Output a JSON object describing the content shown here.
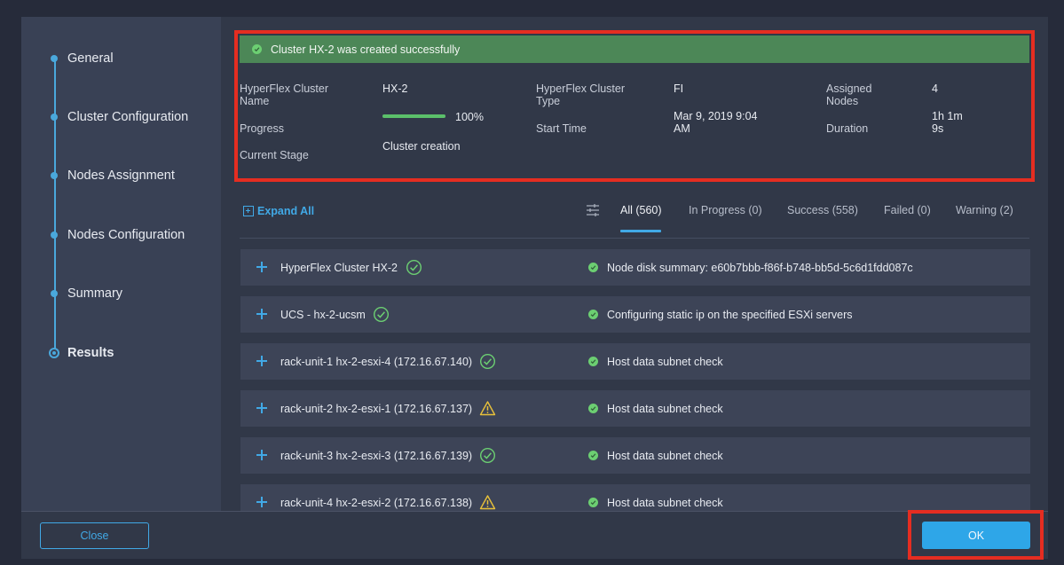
{
  "steps": [
    {
      "label": "General"
    },
    {
      "label": "Cluster Configuration"
    },
    {
      "label": "Nodes Assignment"
    },
    {
      "label": "Nodes Configuration"
    },
    {
      "label": "Summary"
    },
    {
      "label": "Results"
    }
  ],
  "banner": {
    "message": "Cluster HX-2 was created successfully",
    "color": "#4c8757"
  },
  "summary": {
    "cluster_name_label": "HyperFlex Cluster Name",
    "cluster_name_label_l1": "HyperFlex Cluster",
    "cluster_name_label_l2": "Name",
    "cluster_name_value": "HX-2",
    "progress_label": "Progress",
    "progress_value": "100%",
    "progress_fraction": 1.0,
    "current_stage_label": "Current Stage",
    "current_stage_value": "Cluster creation",
    "cluster_type_label_l1": "HyperFlex Cluster",
    "cluster_type_label_l2": "Type",
    "cluster_type_value": "FI",
    "start_time_label": "Start Time",
    "start_time_value_l1": "Mar 9, 2019 9:04",
    "start_time_value_l2": "AM",
    "assigned_nodes_label_l1": "Assigned",
    "assigned_nodes_label_l2": "Nodes",
    "assigned_nodes_value": "4",
    "duration_label": "Duration",
    "duration_value_l1": "1h 1m",
    "duration_value_l2": "9s"
  },
  "toolbar": {
    "expand_all": "Expand All",
    "filter_icon": "filter-sliders-icon"
  },
  "tabs": [
    {
      "label": "All (560)",
      "active": true
    },
    {
      "label": "In Progress (0)"
    },
    {
      "label": "Success (558)"
    },
    {
      "label": "Failed (0)"
    },
    {
      "label": "Warning (2)"
    }
  ],
  "rows": [
    {
      "name": "HyperFlex Cluster HX-2",
      "status": "success",
      "message": "Node disk summary: e60b7bbb-f86f-b748-bb5d-5c6d1fdd087c"
    },
    {
      "name": "UCS - hx-2-ucsm",
      "status": "success",
      "message": "Configuring static ip on the specified ESXi servers"
    },
    {
      "name": "rack-unit-1 hx-2-esxi-4 (172.16.67.140)",
      "status": "success",
      "message": "Host data subnet check"
    },
    {
      "name": "rack-unit-2 hx-2-esxi-1 (172.16.67.137)",
      "status": "warning",
      "message": "Host data subnet check"
    },
    {
      "name": "rack-unit-3 hx-2-esxi-3 (172.16.67.139)",
      "status": "success",
      "message": "Host data subnet check"
    },
    {
      "name": "rack-unit-4 hx-2-esxi-2 (172.16.67.138)",
      "status": "warning",
      "message": "Host data subnet check"
    }
  ],
  "footer": {
    "close_label": "Close",
    "ok_label": "OK"
  },
  "colors": {
    "accent": "#2ea6e8",
    "success": "#6ccf72",
    "warning": "#e8c13a",
    "highlight": "#e52d21"
  }
}
